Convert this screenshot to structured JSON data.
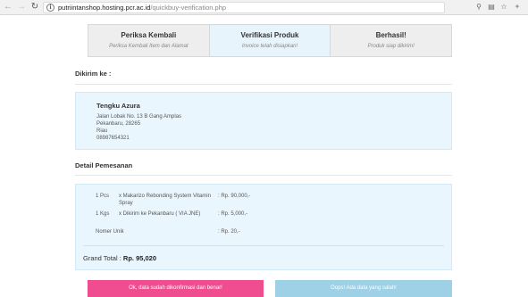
{
  "browser": {
    "url_host": "putriintanshop.hosting.pcr.ac.id",
    "url_path": "/quickbuy-verification.php"
  },
  "steps": [
    {
      "title": "Periksa Kembali",
      "subtitle": "Periksa Kembali Item dan Alamat",
      "active": false
    },
    {
      "title": "Verifikasi Produk",
      "subtitle": "Invoice telah disiapkan!",
      "active": true
    },
    {
      "title": "Berhasil!",
      "subtitle": "Produk siap dikirim!",
      "active": false
    }
  ],
  "shipping": {
    "heading": "Dikirim ke :",
    "name": "Tengku Azura",
    "address": "Jalan Lobak No. 13 B Gang Amplas",
    "city": "Pekanbaru, 28265",
    "province": "Riau",
    "phone": "08987654321"
  },
  "order": {
    "heading": "Detail Pemesanan",
    "items": [
      {
        "qty": "1 Pcs",
        "desc": "x Makarizo Rebonding System Vitamin Spray",
        "price": ": Rp. 90,000,-"
      },
      {
        "qty": "1 Kgs",
        "desc": "x Dikirim ke Pekanbaru ( VIA JNE)",
        "price": ": Rp. 5,000,-"
      },
      {
        "qty": "Nomer Unik",
        "desc": "",
        "price": ": Rp. 20,-"
      }
    ],
    "total_label": "Grand Total :",
    "total_value": "Rp. 95,020"
  },
  "buttons": {
    "confirm": "Ok, data sudah dikonfirmasi dan benar!",
    "wrong": "Oops! Ada data yang salah!"
  },
  "colors": {
    "confirm_bg": "#ef4d8f",
    "wrong_bg": "#9ed0e6",
    "active_step_bg": "#e8f4fb",
    "info_box_bg": "#eaf6fd"
  },
  "icons": {
    "back": "arrow-left-icon",
    "forward": "arrow-right-icon",
    "reload": "reload-icon",
    "info": "info-icon",
    "zoom": "zoom-icon",
    "page": "page-icon",
    "star": "star-icon",
    "extension": "extension-icon"
  }
}
